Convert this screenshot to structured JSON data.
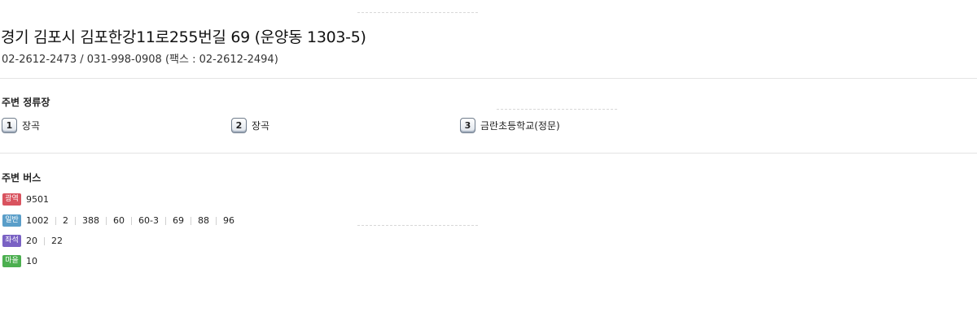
{
  "place": {
    "address": "경기 김포시 김포한강11로255번길 69 (운양동 1303-5)",
    "phones": "02-2612-2473 / 031-998-0908 (팩스 : 02-2612-2494)"
  },
  "stops_section": {
    "title": "주변 정류장",
    "stops": [
      {
        "number": "1",
        "name": "장곡"
      },
      {
        "number": "2",
        "name": "장곡"
      },
      {
        "number": "3",
        "name": "금란초등학교(정문)"
      }
    ]
  },
  "bus_section": {
    "title": "주변 버스",
    "groups": [
      {
        "type": "광역",
        "color": "#d9535f",
        "routes": [
          "9501"
        ]
      },
      {
        "type": "일반",
        "color": "#5a9ec9",
        "routes": [
          "1002",
          "2",
          "388",
          "60",
          "60-3",
          "69",
          "88",
          "96"
        ]
      },
      {
        "type": "좌석",
        "color": "#7a62c4",
        "routes": [
          "20",
          "22"
        ]
      },
      {
        "type": "마을",
        "color": "#4caf50",
        "routes": [
          "10"
        ]
      }
    ]
  }
}
